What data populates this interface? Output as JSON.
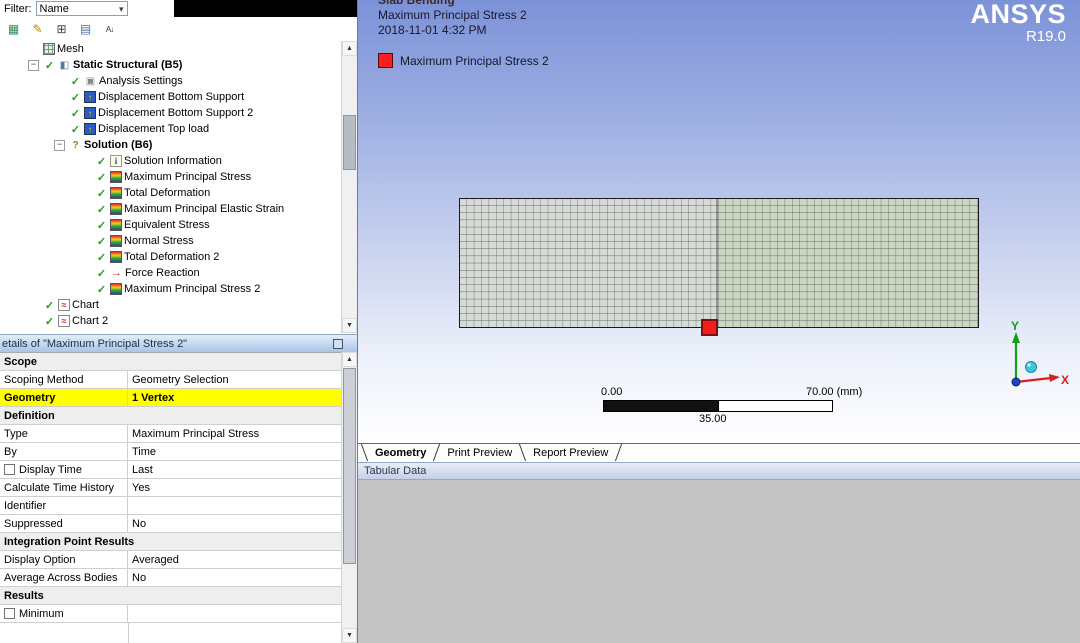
{
  "outline": {
    "filter_label": "Filter:",
    "filter_value": "Name",
    "toolbar": [
      {
        "name": "worksheet-icon"
      },
      {
        "name": "edit-icon"
      },
      {
        "name": "expand-all-icon"
      },
      {
        "name": "figures-icon"
      },
      {
        "name": "sort-icon"
      }
    ]
  },
  "tree": {
    "items": [
      {
        "label": "Mesh",
        "level": 1,
        "icon": "mesh",
        "status": null,
        "expander": null,
        "bold": false
      },
      {
        "label": "Static Structural (B5)",
        "level": 1,
        "icon": "system",
        "status": "check",
        "expander": "minus",
        "bold": true
      },
      {
        "label": "Analysis Settings",
        "level": 2,
        "icon": "settings",
        "status": "check",
        "expander": null,
        "bold": false
      },
      {
        "label": "Displacement Bottom Support",
        "level": 2,
        "icon": "displacement",
        "status": "check",
        "expander": null,
        "bold": false
      },
      {
        "label": "Displacement Bottom Support 2",
        "level": 2,
        "icon": "displacement",
        "status": "check",
        "expander": null,
        "bold": false
      },
      {
        "label": "Displacement Top load",
        "level": 2,
        "icon": "displacement",
        "status": "check",
        "expander": null,
        "bold": false
      },
      {
        "label": "Solution (B6)",
        "level": 2,
        "icon": null,
        "status": "question",
        "expander": "minus",
        "bold": true
      },
      {
        "label": "Solution Information",
        "level": 3,
        "icon": "info",
        "status": "check",
        "expander": null,
        "bold": false
      },
      {
        "label": "Maximum Principal Stress",
        "level": 3,
        "icon": "result",
        "status": "check",
        "expander": null,
        "bold": false
      },
      {
        "label": "Total Deformation",
        "level": 3,
        "icon": "result",
        "status": "check",
        "expander": null,
        "bold": false
      },
      {
        "label": "Maximum Principal Elastic Strain",
        "level": 3,
        "icon": "result",
        "status": "check",
        "expander": null,
        "bold": false
      },
      {
        "label": "Equivalent Stress",
        "level": 3,
        "icon": "result",
        "status": "check",
        "expander": null,
        "bold": false
      },
      {
        "label": "Normal Stress",
        "level": 3,
        "icon": "result",
        "status": "check",
        "expander": null,
        "bold": false
      },
      {
        "label": "Total Deformation 2",
        "level": 3,
        "icon": "result",
        "status": "check",
        "expander": null,
        "bold": false
      },
      {
        "label": "Force Reaction",
        "level": 3,
        "icon": "probe",
        "status": "check",
        "expander": null,
        "bold": false
      },
      {
        "label": "Maximum Principal Stress 2",
        "level": 3,
        "icon": "result",
        "status": "check",
        "expander": null,
        "bold": false
      },
      {
        "label": "Chart",
        "level": 1,
        "icon": "chart",
        "status": "check",
        "expander": null,
        "bold": false
      },
      {
        "label": "Chart 2",
        "level": 1,
        "icon": "chart",
        "status": "check",
        "expander": null,
        "bold": false
      }
    ]
  },
  "details": {
    "title": "etails of \"Maximum Principal Stress 2\"",
    "highlight_color": "#ffff00",
    "rows": [
      {
        "type": "section",
        "label": "Scope"
      },
      {
        "type": "pair",
        "label": "Scoping Method",
        "value": "Geometry Selection"
      },
      {
        "type": "pair",
        "label": "Geometry",
        "value": "1 Vertex",
        "highlight": true
      },
      {
        "type": "section",
        "label": "Definition"
      },
      {
        "type": "pair",
        "label": "Type",
        "value": "Maximum Principal Stress"
      },
      {
        "type": "pair",
        "label": "By",
        "value": "Time"
      },
      {
        "type": "pair",
        "label": "Display Time",
        "value": "Last",
        "checkbox": true
      },
      {
        "type": "pair",
        "label": "Calculate Time History",
        "value": "Yes"
      },
      {
        "type": "pair",
        "label": "Identifier",
        "value": ""
      },
      {
        "type": "pair",
        "label": "Suppressed",
        "value": "No"
      },
      {
        "type": "section",
        "label": "Integration Point Results"
      },
      {
        "type": "pair",
        "label": "Display Option",
        "value": "Averaged"
      },
      {
        "type": "pair",
        "label": "Average Across Bodies",
        "value": "No"
      },
      {
        "type": "section",
        "label": "Results"
      },
      {
        "type": "pair",
        "label": "Minimum",
        "value": "",
        "checkbox": true
      }
    ]
  },
  "viewport": {
    "annotation_lines": [
      "Slab Bending",
      "Maximum Principal Stress 2",
      "2018-11-01 4:32 PM"
    ],
    "legend": {
      "label": "Maximum Principal Stress 2",
      "color": "#fa1e1e"
    },
    "brand": {
      "name": "ANSYS",
      "version": "R19.0"
    },
    "scale_bar": {
      "min": "0.00",
      "max": "70.00 (mm)",
      "mid": "35.00"
    },
    "triad": {
      "x_label": "X",
      "y_label": "Y"
    }
  },
  "view_tabs": {
    "items": [
      {
        "label": "Geometry",
        "active": true
      },
      {
        "label": "Print Preview",
        "active": false
      },
      {
        "label": "Report Preview",
        "active": false
      }
    ]
  },
  "tabular": {
    "title": "Tabular Data"
  }
}
